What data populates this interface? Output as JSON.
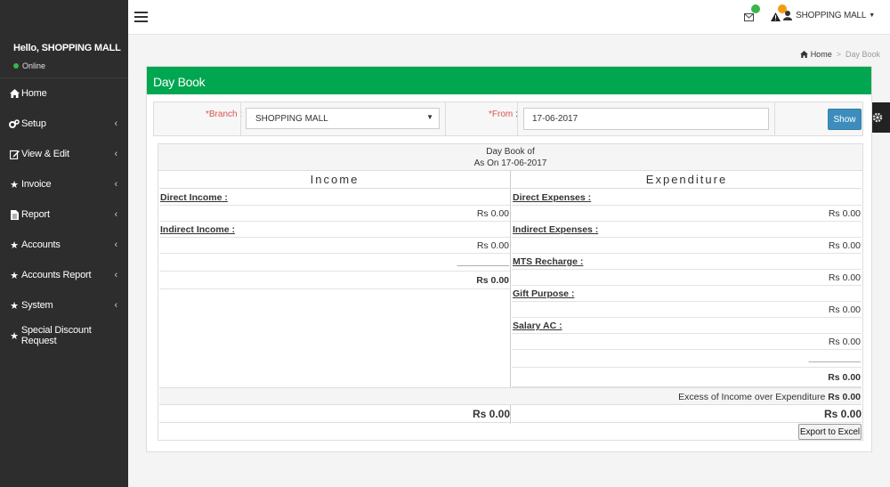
{
  "sidebar": {
    "greeting": "Hello, SHOPPING MALL",
    "status": "Online",
    "items": [
      {
        "label": "Home",
        "icon": "home-icon"
      },
      {
        "label": "Setup",
        "icon": "cogs-icon"
      },
      {
        "label": "View & Edit",
        "icon": "edit-icon"
      },
      {
        "label": "Invoice",
        "icon": "star-icon"
      },
      {
        "label": "Report",
        "icon": "file-icon"
      },
      {
        "label": "Accounts",
        "icon": "star-icon"
      },
      {
        "label": "Accounts Report",
        "icon": "star-icon"
      },
      {
        "label": "System",
        "icon": "star-icon"
      },
      {
        "label": "Special Discount Request",
        "icon": "star-icon"
      }
    ]
  },
  "topbar": {
    "user_name": "SHOPPING MALL",
    "badge_colors": {
      "messages": "#3ab549",
      "alerts": "#f39c12"
    }
  },
  "breadcrumb": {
    "home": "Home",
    "current": "Day Book"
  },
  "page": {
    "title": "Day Book",
    "accent_color": "#00a650"
  },
  "filters": {
    "branch_label": "*Branch",
    "branch_value": "SHOPPING MALL",
    "from_label": "*From",
    "from_value": "17-06-2017",
    "show_label": "Show"
  },
  "report": {
    "title_line1": "Day Book of",
    "title_line2": "As On 17-06-2017",
    "income_header": "Income",
    "expenditure_header": "Expenditure",
    "income": {
      "direct_head": "Direct Income :",
      "direct_amount": "Rs 0.00",
      "indirect_head": "Indirect Income :",
      "indirect_amount": "Rs 0.00",
      "underline": "__________",
      "subtotal": "Rs 0.00"
    },
    "expenditure": {
      "direct_head": "Direct Expenses :",
      "direct_amount": "Rs 0.00",
      "indirect_head": "Indirect Expenses :",
      "indirect_amount": "Rs 0.00",
      "mts_head": "MTS Recharge :",
      "mts_amount": "Rs 0.00",
      "gift_head": "Gift Purpose :",
      "gift_amount": "Rs 0.00",
      "salary_head": "Salary AC :",
      "salary_amount": "Rs 0.00",
      "underline": "__________",
      "subtotal": "Rs 0.00"
    },
    "excess_label": "Excess of Income over Expenditure",
    "excess_amount": "Rs 0.00",
    "income_total": "Rs 0.00",
    "expenditure_total": "Rs 0.00",
    "export_label": "Export to Excel"
  }
}
